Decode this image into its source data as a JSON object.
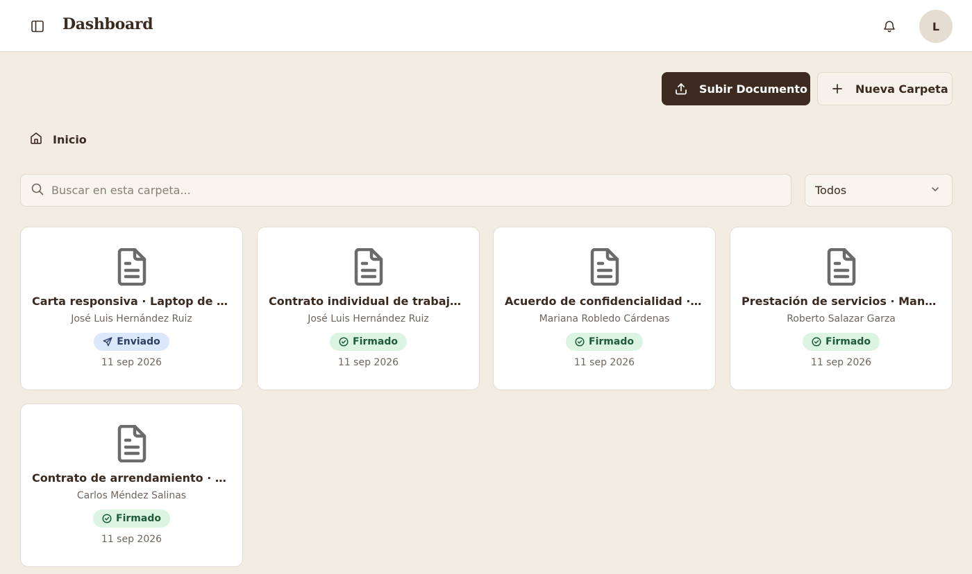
{
  "header": {
    "title": "Dashboard",
    "avatar_initial": "L"
  },
  "actions": {
    "upload_label": "Subir Documento",
    "new_folder_label": "Nueva Carpeta"
  },
  "breadcrumb": {
    "home_label": "Inicio"
  },
  "search": {
    "placeholder": "Buscar en esta carpeta..."
  },
  "filter": {
    "selected": "Todos"
  },
  "documents": [
    {
      "title": "Carta responsiva · Laptop de v...",
      "owner": "José Luis Hernández Ruiz",
      "status": "Enviado",
      "status_key": "enviado",
      "date": "11 sep 2026"
    },
    {
      "title": "Contrato individual de trabajo ·...",
      "owner": "José Luis Hernández Ruiz",
      "status": "Firmado",
      "status_key": "firmado",
      "date": "11 sep 2026"
    },
    {
      "title": "Acuerdo de confidencialidad · ...",
      "owner": "Mariana Robledo Cárdenas",
      "status": "Firmado",
      "status_key": "firmado",
      "date": "11 sep 2026"
    },
    {
      "title": "Prestación de servicios · Mante...",
      "owner": "Roberto Salazar Garza",
      "status": "Firmado",
      "status_key": "firmado",
      "date": "11 sep 2026"
    },
    {
      "title": "Contrato de arrendamiento · De...",
      "owner": "Carlos Méndez Salinas",
      "status": "Firmado",
      "status_key": "firmado",
      "date": "11 sep 2026"
    }
  ],
  "colors": {
    "background": "#f3ece2",
    "primary": "#3d2b22",
    "firmado_bg": "#dcf5e3",
    "enviado_bg": "#dbe7fb"
  },
  "icons": {
    "sidebar_toggle": "sidebar-toggle-icon",
    "notifications": "bell-icon",
    "upload": "upload-icon",
    "new_folder": "plus-icon",
    "home": "home-icon",
    "search": "search-icon",
    "filter": "chevron-down-icon",
    "document": "document-icon",
    "firmado": "check-circle-icon",
    "enviado": "send-icon"
  }
}
